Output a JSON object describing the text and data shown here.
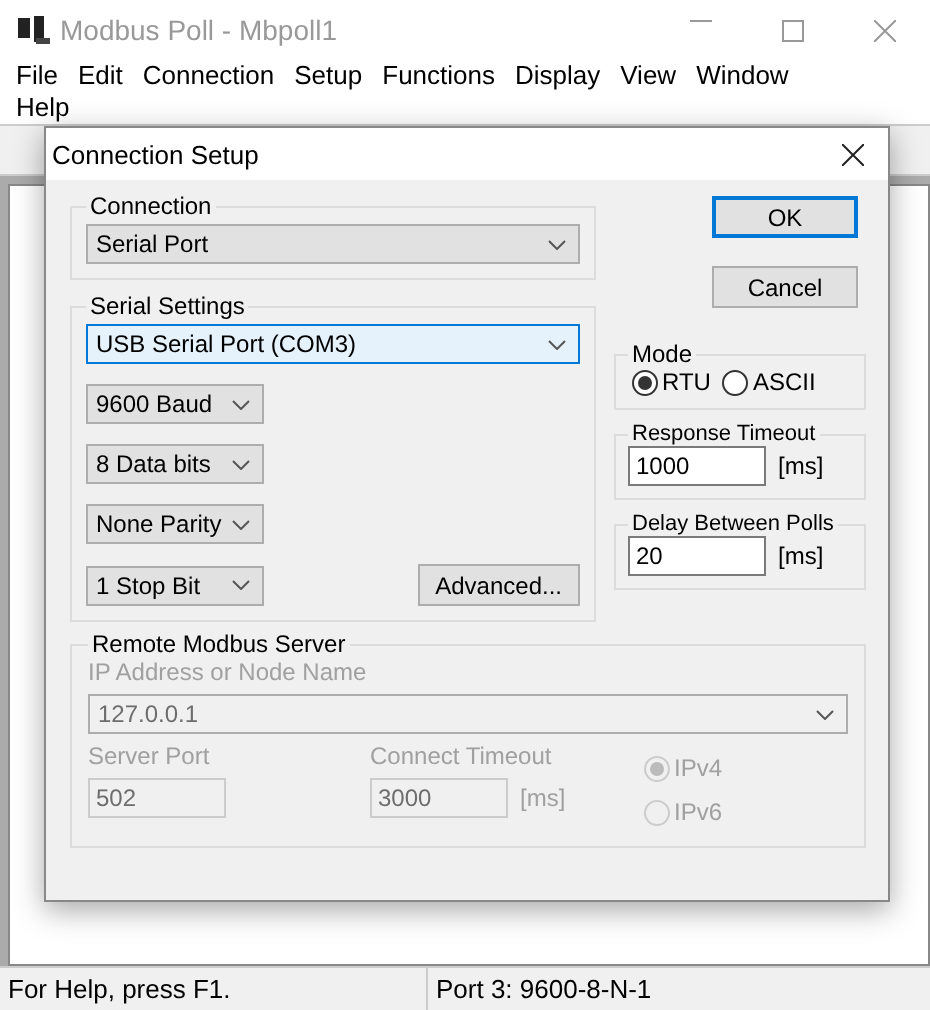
{
  "window": {
    "title": "Modbus Poll - Mbpoll1"
  },
  "menu": [
    "File",
    "Edit",
    "Connection",
    "Setup",
    "Functions",
    "Display",
    "View",
    "Window",
    "Help"
  ],
  "dialog": {
    "title": "Connection Setup",
    "connection": {
      "label": "Connection",
      "value": "Serial Port"
    },
    "serial": {
      "label": "Serial Settings",
      "port": "USB Serial Port (COM3)",
      "focused": true,
      "selects": [
        "9600 Baud",
        "8 Data bits",
        "None Parity",
        "1 Stop Bit"
      ],
      "advanced": "Advanced..."
    },
    "buttons": [
      {
        "label": "OK",
        "default": true
      },
      {
        "label": "Cancel",
        "default": false
      }
    ],
    "mode": {
      "label": "Mode",
      "options": [
        {
          "label": "RTU",
          "selected": true
        },
        {
          "label": "ASCII",
          "selected": false
        }
      ]
    },
    "timeouts": [
      {
        "label": "Response Timeout",
        "value": "1000",
        "unit": "[ms]"
      },
      {
        "label": "Delay Between Polls",
        "value": "20",
        "unit": "[ms]"
      }
    ],
    "remote": {
      "label": "Remote Modbus Server",
      "disabled": true,
      "ip_label": "IP Address or Node Name",
      "ip_value": "127.0.0.1",
      "port_label": "Server Port",
      "port_value": "502",
      "timeout_label": "Connect Timeout",
      "timeout_value": "3000",
      "unit": "[ms]",
      "ip_versions": [
        {
          "label": "IPv4",
          "selected": true
        },
        {
          "label": "IPv6",
          "selected": false
        }
      ]
    }
  },
  "status_bar": [
    "For Help, press F1.",
    "Port 3: 9600-8-N-1"
  ]
}
